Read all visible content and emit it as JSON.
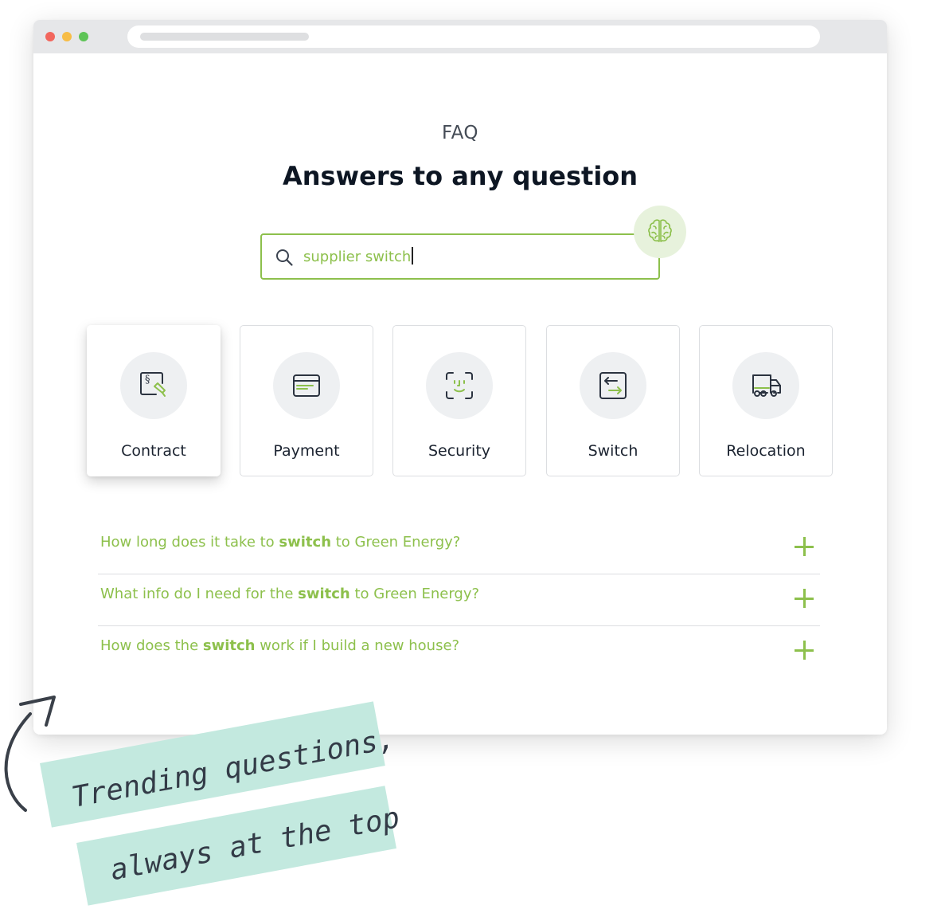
{
  "page": {
    "eyebrow": "FAQ",
    "headline": "Answers to any question"
  },
  "search": {
    "query": "supplier switch",
    "icon": "search-icon",
    "ai_icon": "brain-icon"
  },
  "categories": [
    {
      "label": "Contract",
      "icon": "contract-icon",
      "active": true
    },
    {
      "label": "Payment",
      "icon": "credit-card-icon",
      "active": false
    },
    {
      "label": "Security",
      "icon": "face-id-icon",
      "active": false
    },
    {
      "label": "Switch",
      "icon": "switch-arrows-icon",
      "active": false
    },
    {
      "label": "Relocation",
      "icon": "moving-truck-icon",
      "active": false
    }
  ],
  "faqs": [
    {
      "before": "How long does it take to ",
      "keyword": "switch",
      "after": " to Green Energy?"
    },
    {
      "before": "What info do I need for the ",
      "keyword": "switch",
      "after": " to Green Energy?"
    },
    {
      "before": "How does the ",
      "keyword": "switch",
      "after": " work if I build a new house?"
    }
  ],
  "annotation": {
    "line1": "Trending questions,",
    "line2": "always at the top"
  },
  "colors": {
    "accent": "#8dc04c",
    "headline": "#0d1623",
    "note_bg": "#c3e9df"
  }
}
